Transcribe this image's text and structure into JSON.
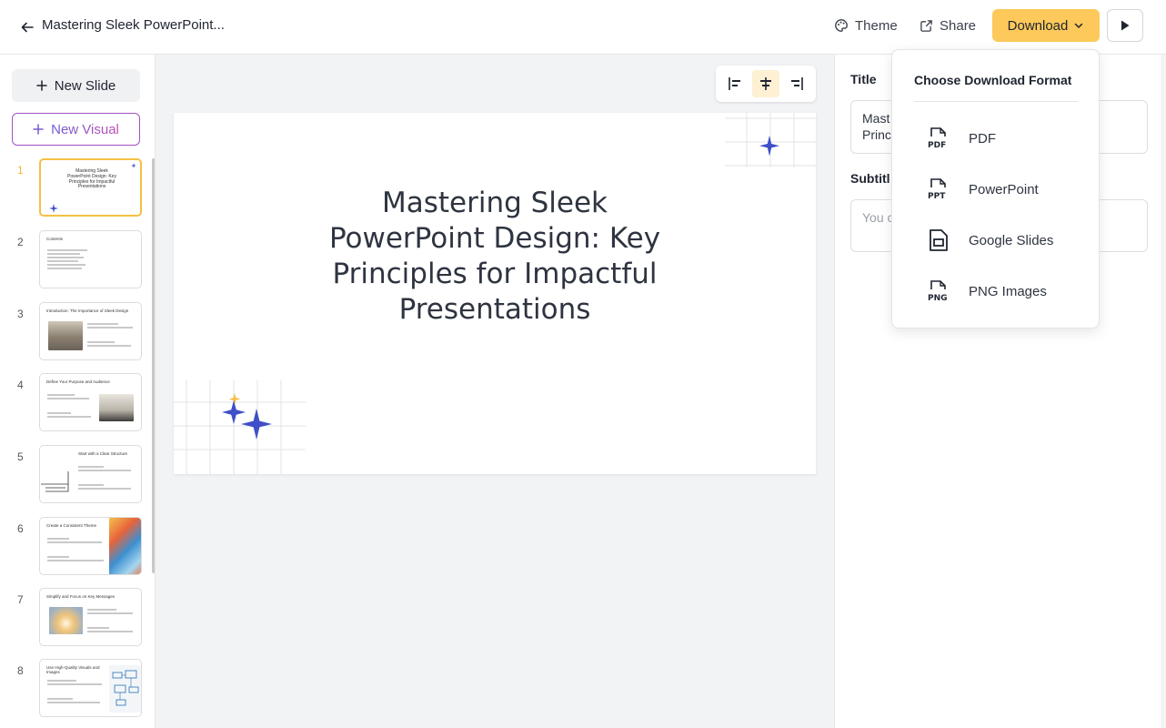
{
  "header": {
    "title": "Mastering Sleek PowerPoint...",
    "theme_label": "Theme",
    "share_label": "Share",
    "download_label": "Download",
    "accent_color": "#fcc95a"
  },
  "sidebar": {
    "new_slide_label": "New Slide",
    "new_visual_label": "New Visual",
    "slides": [
      {
        "num": "1",
        "title": "Mastering Sleek PowerPoint Design: Key Principles for Impactful Presentations",
        "active": true
      },
      {
        "num": "2",
        "title": "Contents"
      },
      {
        "num": "3",
        "title": "Introduction: The Importance of Sleek Design"
      },
      {
        "num": "4",
        "title": "Define Your Purpose and Audience"
      },
      {
        "num": "5",
        "title": "Start with a Clear Structure"
      },
      {
        "num": "6",
        "title": "Create a Consistent Theme"
      },
      {
        "num": "7",
        "title": "Simplify and Focus on Key Messages"
      },
      {
        "num": "8",
        "title": "Use High-Quality Visuals and Images"
      }
    ]
  },
  "canvas": {
    "slide_title": "Mastering Sleek PowerPoint Design: Key Principles for Impactful Presentations",
    "align_options": [
      "align-left",
      "align-center",
      "align-right"
    ],
    "active_align": "align-center"
  },
  "panel": {
    "title_label": "Title",
    "title_value_line1": "Mast",
    "title_value_line2": "Princ",
    "subtitle_label": "Subtitl",
    "subtitle_placeholder": "You c"
  },
  "download_menu": {
    "heading": "Choose Download Format",
    "options": [
      {
        "label": "PDF",
        "icon": "pdf-file-icon"
      },
      {
        "label": "PowerPoint",
        "icon": "ppt-file-icon"
      },
      {
        "label": "Google Slides",
        "icon": "google-slides-icon"
      },
      {
        "label": "PNG Images",
        "icon": "png-file-icon"
      }
    ]
  }
}
